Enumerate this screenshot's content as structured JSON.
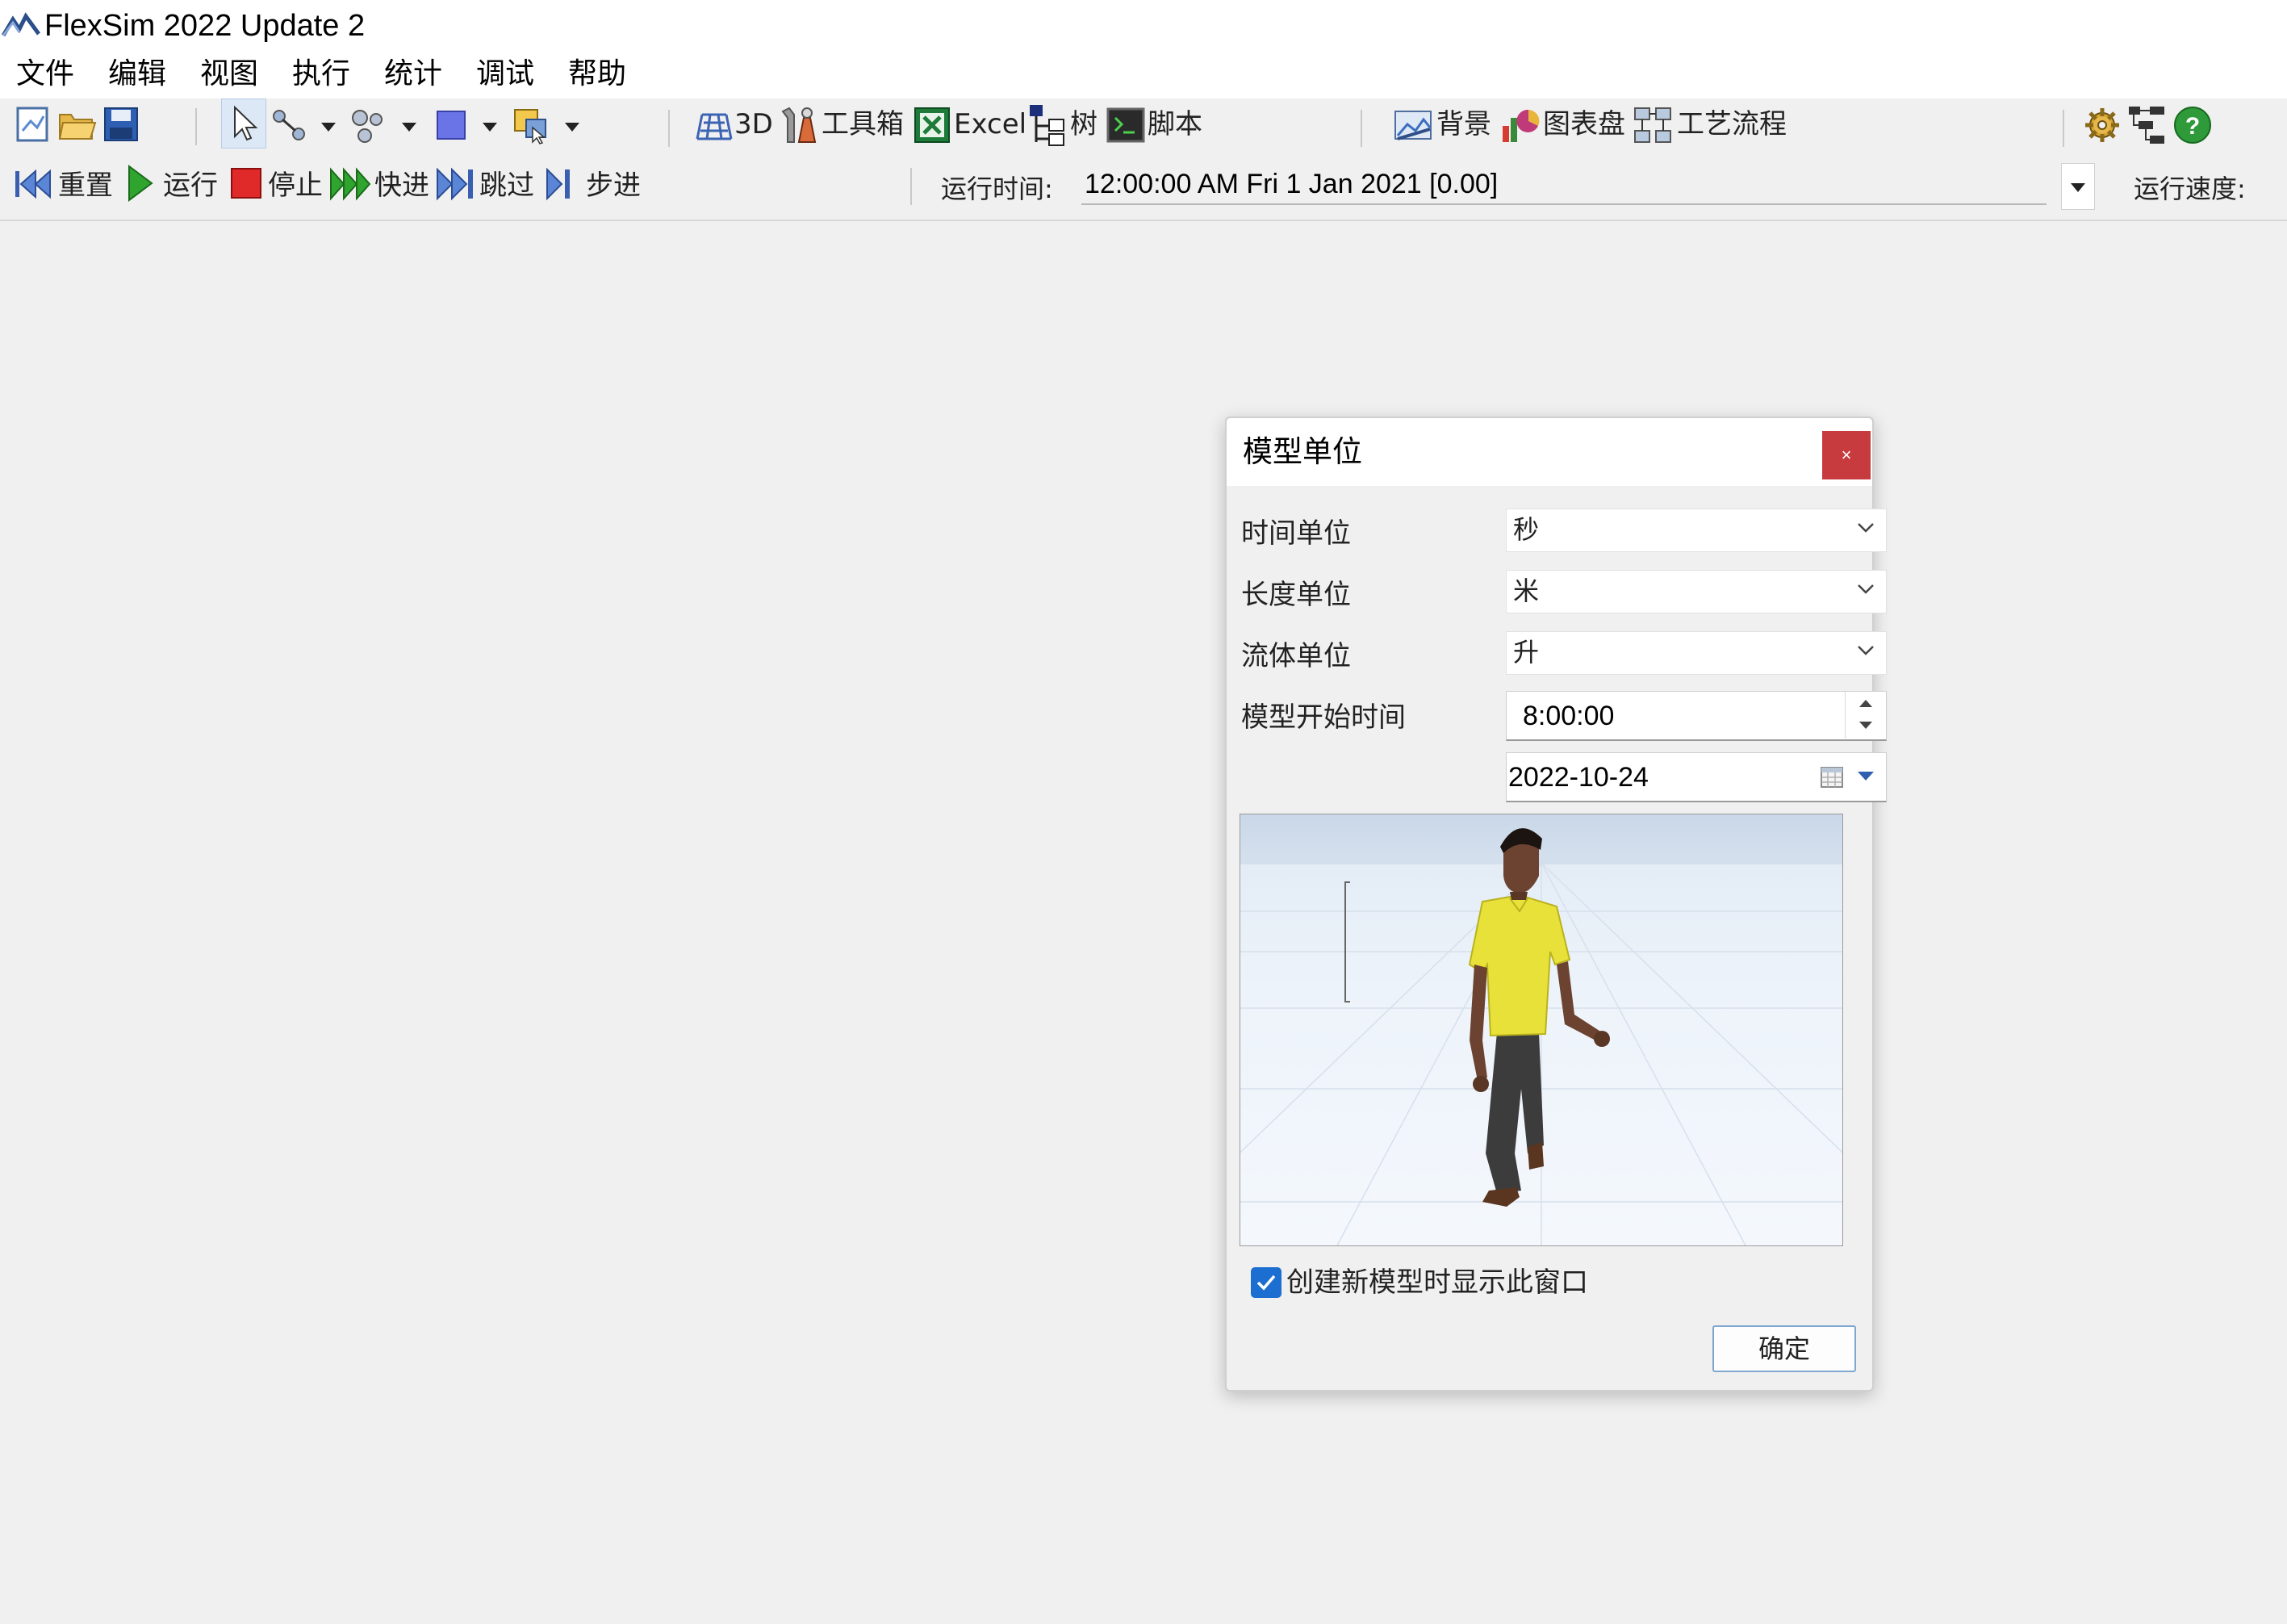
{
  "window": {
    "title": "FlexSim 2022 Update 2"
  },
  "menu": {
    "items": [
      "文件",
      "编辑",
      "视图",
      "执行",
      "统计",
      "调试",
      "帮助"
    ]
  },
  "toolbar": {
    "view_3d": "3D",
    "toolbox": "工具箱",
    "excel": "Excel",
    "tree": "树",
    "script": "脚本",
    "background": "背景",
    "dashboard": "图表盘",
    "process_flow": "工艺流程"
  },
  "run_controls": {
    "reset": "重置",
    "run": "运行",
    "stop": "停止",
    "fast_forward": "快进",
    "skip": "跳过",
    "step": "步进",
    "run_time_label": "运行时间:",
    "run_time_value": "12:00:00 AM  Fri 1 Jan 2021  [0.00]",
    "run_speed_label": "运行速度:"
  },
  "dialog": {
    "title": "模型单位",
    "close": "×",
    "time_unit_label": "时间单位",
    "time_unit_value": "秒",
    "length_unit_label": "长度单位",
    "length_unit_value": "米",
    "fluid_unit_label": "流体单位",
    "fluid_unit_value": "升",
    "start_time_label": "模型开始时间",
    "start_time_value": "8:00:00",
    "start_date_value": "2022-10-24",
    "show_on_new_label": "创建新模型时显示此窗口",
    "show_on_new_checked": true,
    "ok": "确定"
  },
  "colors": {
    "accent": "#1c6fd0",
    "close_button": "#c73b3f",
    "shirt": "#e8e13a"
  }
}
